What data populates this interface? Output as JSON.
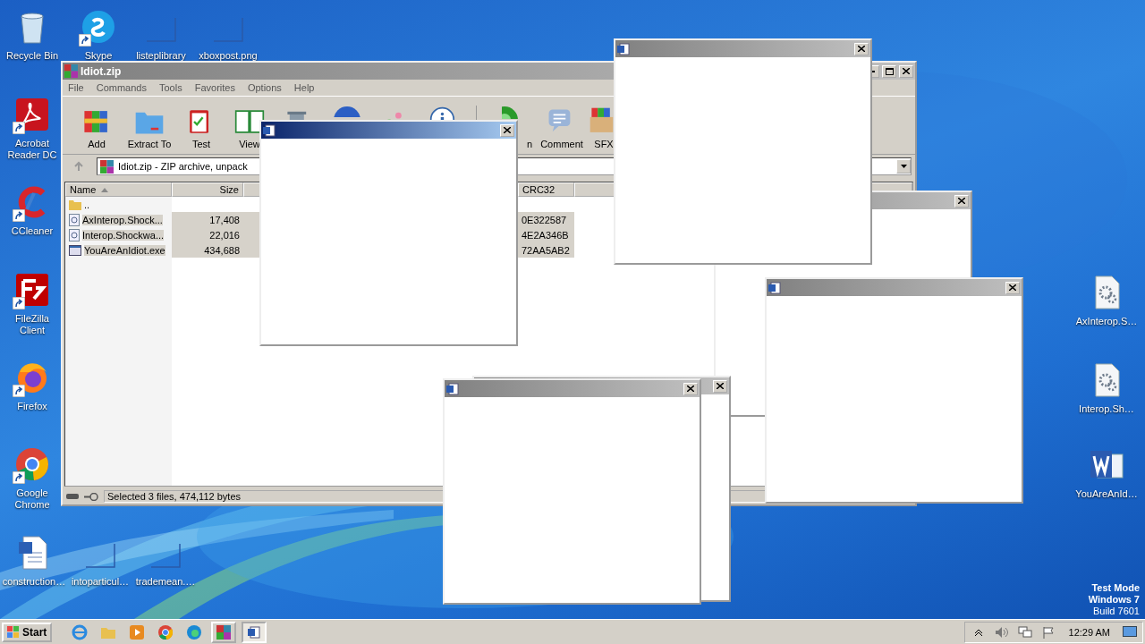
{
  "desktop": {
    "icons": [
      {
        "label": "Recycle Bin",
        "kind": "recycle-bin",
        "shortcut": false
      },
      {
        "label": "Skype",
        "kind": "skype",
        "shortcut": true
      },
      {
        "label": "listeplibrary",
        "kind": "blank",
        "shortcut": false
      },
      {
        "label": "xboxpost.png",
        "kind": "blank",
        "shortcut": false
      },
      {
        "label": "Acrobat Reader DC",
        "kind": "reader",
        "shortcut": true
      },
      {
        "label": "CCleaner",
        "kind": "cleaner",
        "shortcut": true
      },
      {
        "label": "FileZilla Client",
        "kind": "filezilla",
        "shortcut": true
      },
      {
        "label": "Firefox",
        "kind": "firefox",
        "shortcut": true
      },
      {
        "label": "Google Chrome",
        "kind": "chrome",
        "shortcut": true
      },
      {
        "label": "construction…",
        "kind": "word-doc",
        "shortcut": false
      },
      {
        "label": "intoparticul…",
        "kind": "blank",
        "shortcut": false
      },
      {
        "label": "trademean.…",
        "kind": "blank",
        "shortcut": false
      },
      {
        "label": "AxInterop.S…",
        "kind": "gear-file",
        "shortcut": false
      },
      {
        "label": "Interop.Sh…",
        "kind": "gear-file",
        "shortcut": false
      },
      {
        "label": "YouAreAnId…",
        "kind": "word",
        "shortcut": false
      }
    ],
    "os_notice": [
      "Test Mode",
      "Windows 7",
      "Build 7601"
    ]
  },
  "archive_window": {
    "title": "Idiot.zip",
    "active": false,
    "menu": [
      "File",
      "Commands",
      "Tools",
      "Favorites",
      "Options",
      "Help"
    ],
    "toolbar": [
      {
        "kind": "add",
        "label": "Add"
      },
      {
        "kind": "extract",
        "label": "Extract To"
      },
      {
        "kind": "test",
        "label": "Test"
      },
      {
        "kind": "view",
        "label": "View"
      },
      {
        "kind": "delete"
      },
      {
        "kind": "find"
      },
      {
        "kind": "wizard"
      },
      {
        "kind": "info"
      },
      {
        "kind": "scan",
        "label": "n"
      },
      {
        "kind": "comment",
        "label": "Comment"
      },
      {
        "kind": "sfx",
        "label": "SFX"
      }
    ],
    "address": "Idiot.zip - ZIP archive, unpack",
    "columns": [
      {
        "label": "Name",
        "sorted": true
      },
      {
        "label": "Size",
        "sorted": false
      },
      {
        "label": "CRC32",
        "sorted": false
      }
    ],
    "rows": [
      {
        "kind": "parent",
        "name": "..",
        "selected": false
      },
      {
        "kind": "dll",
        "name": "AxInterop.Shock...",
        "size": "17,408",
        "crc32": "0E322587",
        "selected": true
      },
      {
        "kind": "dll",
        "name": "Interop.Shockwa...",
        "size": "22,016",
        "crc32": "4E2A346B",
        "selected": true
      },
      {
        "kind": "exe",
        "name": "YouAreAnIdiot.exe",
        "size": "434,688",
        "crc32": "72AA5AB2",
        "selected": true
      }
    ],
    "status": "Selected 3 files, 474,112 bytes"
  },
  "popup_windows": [
    {
      "active": false
    },
    {
      "active": false
    },
    {
      "active": false
    },
    {
      "active": false
    },
    {
      "active": false
    },
    {
      "active": true
    }
  ],
  "taskbar": {
    "start": "Start",
    "quick_launch": [
      {
        "kind": "ie"
      },
      {
        "kind": "explorer"
      },
      {
        "kind": "media"
      },
      {
        "kind": "chrome"
      },
      {
        "kind": "edge"
      }
    ],
    "tasks": [
      {
        "kind": "winrar",
        "selected": false
      },
      {
        "kind": "word",
        "selected": true
      }
    ],
    "tray": [
      {
        "kind": "chevron"
      },
      {
        "kind": "speaker"
      },
      {
        "kind": "network"
      },
      {
        "kind": "flag"
      }
    ],
    "clock": "12:29 AM"
  }
}
